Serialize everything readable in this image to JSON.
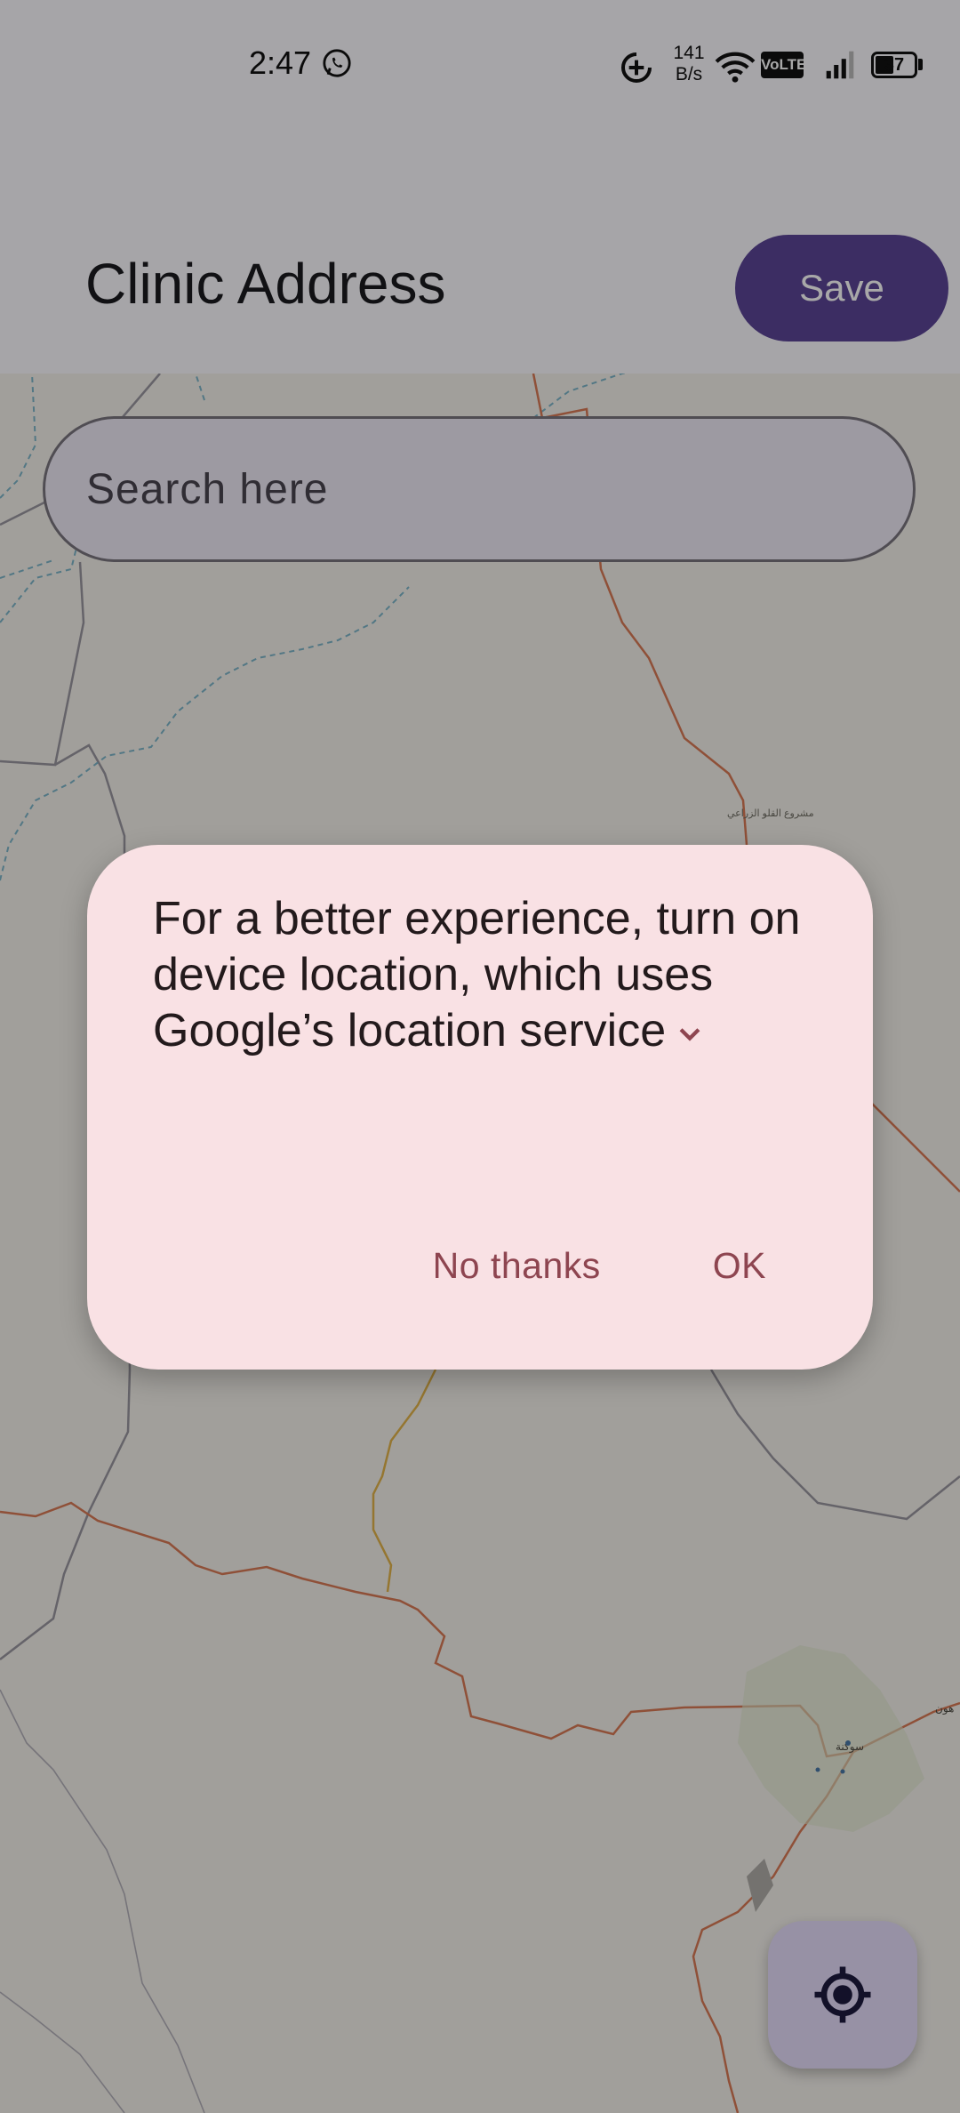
{
  "status_bar": {
    "time": "2:47",
    "net_speed_value": "141",
    "net_speed_unit": "B/s",
    "volte": "VoLTE",
    "battery": "37"
  },
  "app_bar": {
    "title": "Clinic Address",
    "save_label": "Save"
  },
  "search": {
    "placeholder": "Search here"
  },
  "map": {
    "labels": [
      "مشروع القلو الزراعي",
      "سوكنة",
      "هون"
    ]
  },
  "dialog": {
    "message": "For a better experience, turn on device location, which uses Google’s location service",
    "no_thanks_label": "No thanks",
    "ok_label": "OK"
  },
  "icons": {
    "whatsapp": "whatsapp-icon",
    "data_saver": "data-saver-icon",
    "wifi": "wifi-icon",
    "signal": "signal-icon",
    "battery": "battery-icon",
    "locate": "my-location-icon",
    "expand": "chevron-down-icon"
  },
  "colors": {
    "primary": "#5b4596",
    "dialog_bg": "#f9e1e4",
    "dialog_action": "#8e4550",
    "fab_bg": "#e6ddfb",
    "map_bg": "#f4f1ec",
    "map_road": "#d97a55",
    "map_border": "#9a97a0",
    "map_wadi": "#7db5c9"
  }
}
